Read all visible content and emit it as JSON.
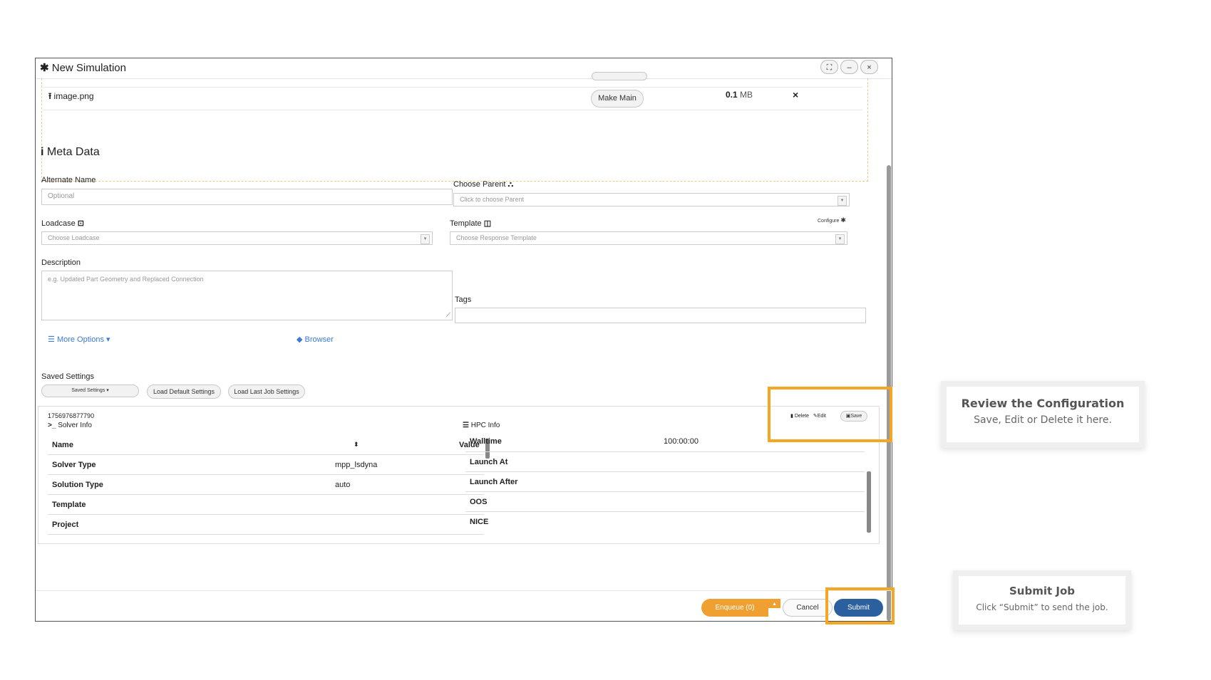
{
  "modal": {
    "title": "New Simulation",
    "window_buttons": [
      "⛶",
      "–",
      "×"
    ]
  },
  "file": {
    "name": "image.png",
    "make_main": "Make Main",
    "size_value": "0.1",
    "size_unit": "MB",
    "remove": "×"
  },
  "meta": {
    "heading": "Meta Data",
    "alternate_name_label": "Alternate Name",
    "alternate_name_placeholder": "Optional",
    "choose_parent_label": "Choose Parent",
    "choose_parent_placeholder": "Click to choose Parent",
    "loadcase_label": "Loadcase",
    "loadcase_placeholder": "Choose Loadcase",
    "template_label": "Template",
    "template_placeholder": "Choose Response Template",
    "configure_label": "Configure",
    "description_label": "Description",
    "description_placeholder": "e.g. Updated Part Geometry and Replaced Connection",
    "tags_label": "Tags",
    "more_options": "More Options",
    "browser": "Browser"
  },
  "saved_settings": {
    "label": "Saved Settings",
    "dropdown": "Saved Settings",
    "load_default": "Load Default Settings",
    "load_last": "Load Last Job Settings",
    "config_id": "1756976877790",
    "delete": "Delete",
    "edit": "Edit",
    "save": "Save"
  },
  "solver_info": {
    "heading": "Solver Info",
    "col_name": "Name",
    "col_value": "Value",
    "rows": [
      {
        "name": "Solver Type",
        "value": "mpp_lsdyna"
      },
      {
        "name": "Solution Type",
        "value": "auto"
      },
      {
        "name": "Template",
        "value": ""
      },
      {
        "name": "Project",
        "value": ""
      }
    ]
  },
  "hpc_info": {
    "heading": "HPC Info",
    "rows": [
      {
        "name": "Walltime",
        "value": "100:00:00"
      },
      {
        "name": "Launch At",
        "value": ""
      },
      {
        "name": "Launch After",
        "value": ""
      },
      {
        "name": "OOS",
        "value": ""
      },
      {
        "name": "NICE",
        "value": ""
      }
    ]
  },
  "footer": {
    "enqueue": "Enqueue (0)",
    "cancel": "Cancel",
    "submit": "Submit"
  },
  "callouts": {
    "review_title": "Review the Configuration",
    "review_text": "Save, Edit or Delete it here.",
    "submit_title": "Submit Job",
    "submit_text": "Click “Submit” to send the job."
  },
  "colors": {
    "highlight": "#f5a623",
    "submit": "#2b5f9e",
    "enqueue": "#f0a030",
    "link": "#3a7bd5"
  }
}
